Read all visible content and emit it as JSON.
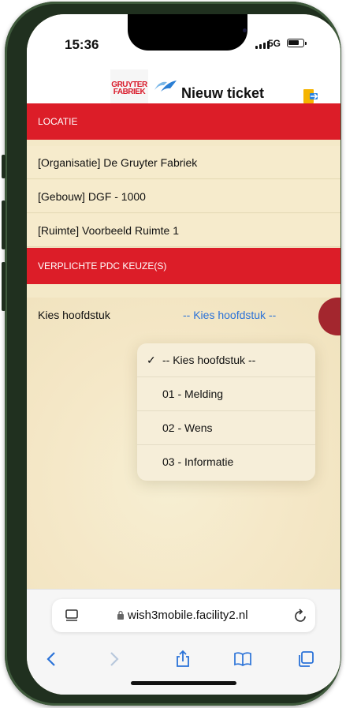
{
  "status_bar": {
    "time": "15:36",
    "network": "5G"
  },
  "header": {
    "title": "Nieuw ticket",
    "logo_text_line1": "GRUYTER",
    "logo_text_line2": "FABRIEK"
  },
  "location_section": {
    "title": "LOCATIE",
    "rows": [
      "[Organisatie] De Gruyter Fabriek",
      "[Gebouw] DGF - 1000",
      "[Ruimte] Voorbeeld Ruimte 1"
    ]
  },
  "pdc_section": {
    "title": "VERPLICHTE PDC KEUZE(S)",
    "field_label": "Kies hoofdstuk",
    "field_value": "-- Kies hoofdstuk --"
  },
  "dropdown": {
    "options": [
      {
        "label": "-- Kies hoofdstuk --",
        "check": "✓"
      },
      {
        "label": "01 - Melding",
        "check": ""
      },
      {
        "label": "02 - Wens",
        "check": ""
      },
      {
        "label": "03 - Informatie",
        "check": ""
      }
    ]
  },
  "browser": {
    "url": "wish3mobile.facility2.nl"
  },
  "colors": {
    "accent_red": "#dc1d28",
    "link_blue": "#2a72d8",
    "background": "#f4e9c8"
  }
}
